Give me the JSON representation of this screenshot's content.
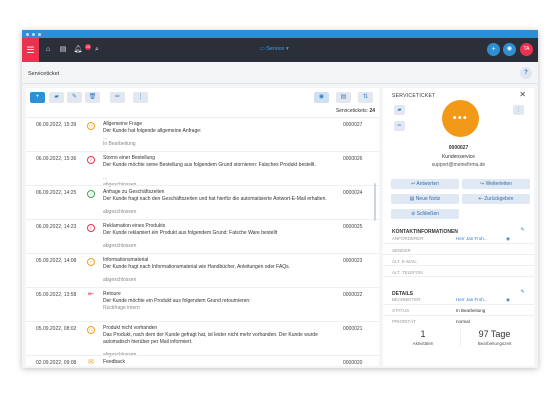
{
  "appbar": {
    "service_label": "Service ▾",
    "notification_count": "10",
    "user_initials": "TA"
  },
  "subheader": {
    "title": "Serviceticket",
    "help_label": "?"
  },
  "list": {
    "count_label": "Servicetickets:",
    "count_value": "24",
    "rows": [
      {
        "date": "06.09.2022, 15:39",
        "title": "Allgemeine Frage",
        "desc": "Der Kunde hat folgende allgemeine Anfrage:",
        "extra": "...",
        "status": "In Bearbeitung",
        "number": "0000027",
        "icon": "clock-icon",
        "color": "#f0a020"
      },
      {
        "date": "06.09.2022, 15:36",
        "title": "Storno einer Bestellung",
        "desc": "Der Kunde möchte seine Bestellung aus folgendem Grund stornieren: Falsches Produkt bestellt.",
        "extra": "...",
        "status": "abgeschlossen",
        "number": "0000026",
        "icon": "check-icon",
        "color": "#e8334f"
      },
      {
        "date": "06.09.2022, 14:25",
        "title": "Anfrage zu Geschäftszeiten",
        "desc": "Der Kunde fragt nach den Geschäftszeiten und hat hierfür die automatisierte Antwort-E-Mail erhalten.",
        "extra": "",
        "status": "abgeschlossen",
        "number": "0000024",
        "icon": "check-icon",
        "color": "#3aa65a"
      },
      {
        "date": "06.09.2022, 14:23",
        "title": "Reklamation eines Produkts",
        "desc": "Der Kunde reklamiert ein Produkt aus folgendem Grund: Falsche Ware bestellt",
        "extra": "",
        "status": "abgeschlossen",
        "number": "0000025",
        "icon": "check-icon",
        "color": "#e8334f"
      },
      {
        "date": "05.09.2022, 14:08",
        "title": "Informationsmaterial",
        "desc": "Der Kunde fragt nach Informationsmaterial wie Handbücher, Anleitungen oder FAQs.",
        "extra": "",
        "status": "abgeschlossen",
        "number": "0000023",
        "icon": "check-icon",
        "color": "#f0a020"
      },
      {
        "date": "05.09.2022, 13:58",
        "title": "Retoure",
        "desc": "Der Kunde möchte ein Produkt aus folgendem Grund retournieren:",
        "extra": "",
        "status": "Rückfrage intern",
        "number": "0000022",
        "icon": "return-icon",
        "color": "#e8334f"
      },
      {
        "date": "05.09.2022, 08:02",
        "title": "Produkt nicht vorhanden",
        "desc": "Das Produkt, nach dem der Kunde gefragt hat, ist leider nicht mehr vorhanden. Der Kunde wurde automatisch hierüber per Mail informiert.",
        "extra": "",
        "status": "abgeschlossen",
        "number": "0000021",
        "icon": "clock-icon",
        "color": "#f0a020"
      },
      {
        "date": "02.09.2022, 09:08",
        "title": "Feedback",
        "desc": "",
        "extra": "",
        "status": "",
        "number": "0000020",
        "icon": "mail-icon",
        "color": "#f0a020"
      }
    ]
  },
  "detail": {
    "header": "SERVICETICKET",
    "close_label": "✕",
    "avatar_text": "•••",
    "ticket_number": "0000027",
    "department": "Kundenservice",
    "email": "support@meinefirma.de",
    "actions": {
      "reply": "Antworten",
      "forward": "Weiterleiten",
      "new_note": "Neue Notiz",
      "reset": "Zurückgeben",
      "close": "Schließen"
    },
    "contact": {
      "heading": "KONTAKTINFORMATIONEN",
      "requester_label": "ANFORDERER",
      "requester_value": "Herr Jan Froh...",
      "sender_label": "SENDER",
      "email_label": "ALT. E-MAIL",
      "phone_label": "ALT. TELEFON"
    },
    "details": {
      "heading": "DETAILS",
      "editor_label": "BEARBEITER",
      "editor_value": "Herr Jan Froh...",
      "status_label": "STATUS",
      "status_value": "In Bearbeitung",
      "priority_label": "PRIORITÄT",
      "priority_value": "normal"
    },
    "stats": {
      "activities_value": "1",
      "activities_label": "Aktivitäten",
      "time_value": "97 Tage",
      "time_label": "Bearbeitungszeit"
    }
  },
  "colors": {
    "appbar": "#2b2f3a",
    "accent": "#2f8fd3",
    "brand_red": "#e8334f",
    "avatar": "#f29a18"
  }
}
